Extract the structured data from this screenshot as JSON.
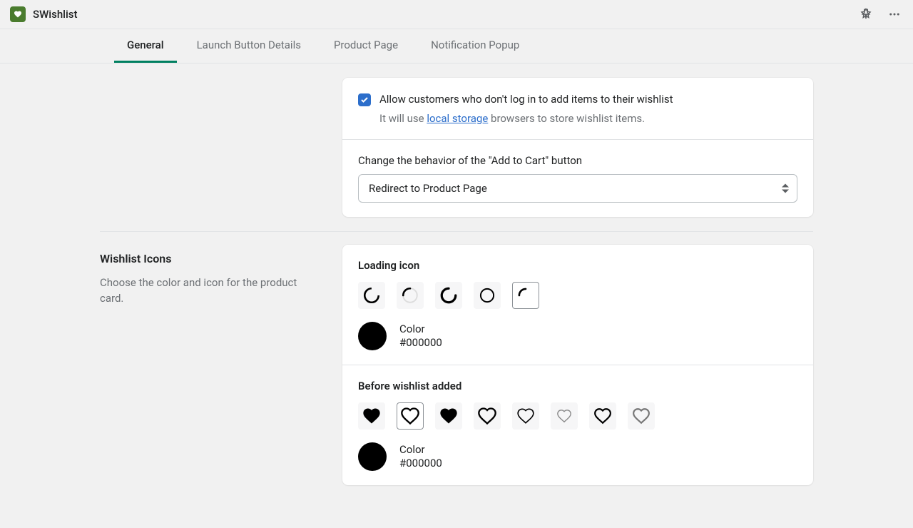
{
  "header": {
    "app_name": "SWishlist"
  },
  "tabs": [
    {
      "label": "General",
      "active": true
    },
    {
      "label": "Launch Button Details",
      "active": false
    },
    {
      "label": "Product Page",
      "active": false
    },
    {
      "label": "Notification Popup",
      "active": false
    }
  ],
  "settings": {
    "anon_checkbox_label": "Allow customers who don't log in to add items to their wishlist",
    "anon_sub_prefix": "It will use ",
    "anon_sub_link": "local storage",
    "anon_sub_suffix": " browsers to store wishlist items.",
    "atc_label": "Change the behavior of the \"Add to Cart\" button",
    "atc_value": "Redirect to Product Page"
  },
  "icons_section": {
    "title": "Wishlist Icons",
    "desc": "Choose the color and icon for the product card.",
    "loading_heading": "Loading icon",
    "loading_color_label": "Color",
    "loading_color_value": "#000000",
    "before_heading": "Before wishlist added",
    "before_color_label": "Color",
    "before_color_value": "#000000"
  }
}
